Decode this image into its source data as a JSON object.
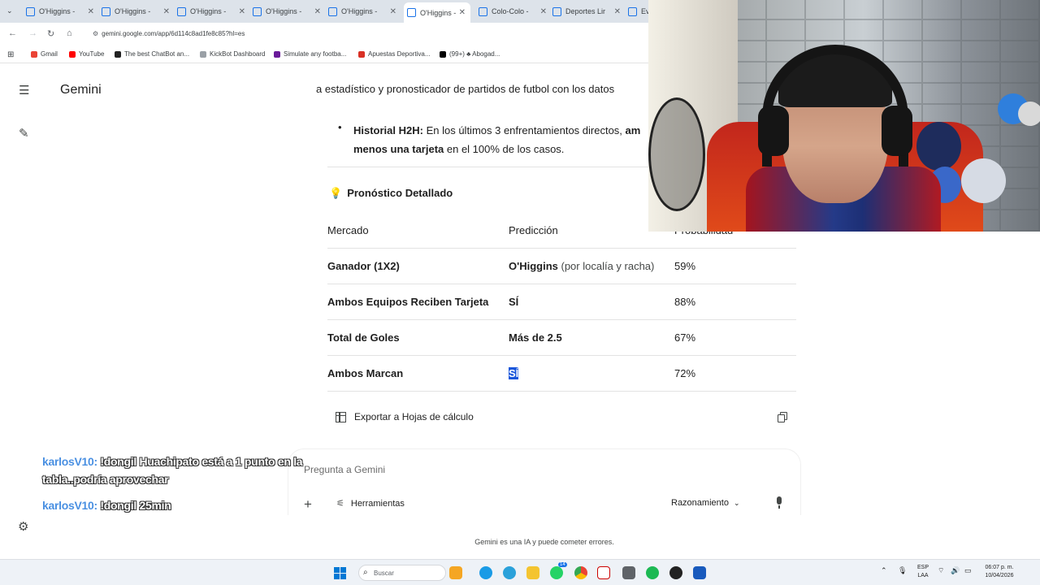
{
  "browser": {
    "tabs": [
      {
        "title": "O'Higgins -",
        "favicon": "gemini-tab-icon"
      },
      {
        "title": "O'Higgins -",
        "favicon": "gemini-tab-icon"
      },
      {
        "title": "O'Higgins -",
        "favicon": "gemini-tab-icon"
      },
      {
        "title": "O'Higgins -",
        "favicon": "gemini-tab-icon"
      },
      {
        "title": "O'Higgins -",
        "favicon": "gemini-tab-icon"
      },
      {
        "title": "O'Higgins -",
        "favicon": "gemini-tab-icon"
      },
      {
        "title": "Colo-Colo -",
        "favicon": "gemini-tab-icon"
      },
      {
        "title": "Deportes Lir",
        "favicon": "gemini-tab-icon"
      },
      {
        "title": "Eve",
        "favicon": "gemini-tab-icon"
      }
    ],
    "url": "gemini.google.com/app/6d114c8ad1fe8c85?hl=es",
    "bookmarks": [
      {
        "label": "Gmail",
        "color": "#ea4335"
      },
      {
        "label": "YouTube",
        "color": "#ff0000"
      },
      {
        "label": "The best ChatBot an...",
        "color": "#222222"
      },
      {
        "label": "KickBot Dashboard",
        "color": "#9aa0a6"
      },
      {
        "label": "Simulate any footba...",
        "color": "#6a1b9a"
      },
      {
        "label": "Apuestas Deportiva...",
        "color": "#d93025"
      },
      {
        "label": "(99+) ♣ Abogad...",
        "color": "#000000"
      }
    ]
  },
  "app": {
    "brand": "Gemini",
    "intro_text": "a estadístico y pronosticador de partidos de futbol con los datos",
    "bullet": {
      "label": "Historial H2H:",
      "text": " En los últimos 3 enfrentamientos directos, ",
      "bold_tail": "am",
      "line2_bold": "menos una tarjeta",
      "line2_text": " en el 100% de los casos."
    },
    "section_title": "Pronóstico Detallado",
    "table": {
      "headers": [
        "Mercado",
        "Predicción",
        "Probabilidad"
      ],
      "rows": [
        {
          "market": "Ganador (1X2)",
          "prediction": "O'Higgins",
          "note": " (por localía y racha)",
          "probability": "59%"
        },
        {
          "market": "Ambos Equipos Reciben Tarjeta",
          "prediction": "SÍ",
          "note": "",
          "probability": "88%"
        },
        {
          "market": "Total de Goles",
          "prediction": "Más de 2.5",
          "note": "",
          "probability": "67%"
        },
        {
          "market": "Ambos Marcan",
          "prediction": "SÍ",
          "note": "",
          "probability": "72%"
        }
      ]
    },
    "export_label": "Exportar a Hojas de cálculo",
    "prompt_placeholder": "Pregunta a Gemini",
    "tools_label": "Herramientas",
    "mode_label": "Razonamiento",
    "disclaimer": "Gemini es una IA y puede cometer errores."
  },
  "chat_overlay": [
    {
      "user": "karlosV10:",
      "message": " !dongil Huachipato está a 1 punto en la",
      "message2": "tabla..podría aprovechar"
    },
    {
      "user": "karlosV10:",
      "message": " !dongil 25min",
      "message2": ""
    }
  ],
  "taskbar": {
    "search_placeholder": "Buscar",
    "lang_line1": "ESP",
    "lang_line2": "LAA",
    "time": "06:07 p. m.",
    "date": "10/04/2026",
    "badge": "14"
  }
}
